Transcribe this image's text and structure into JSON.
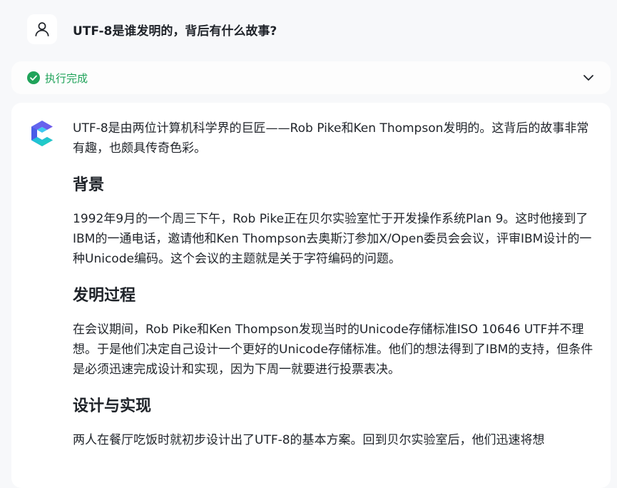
{
  "question": {
    "text": "UTF-8是谁发明的，背后有什么故事?"
  },
  "status": {
    "text": "执行完成",
    "color": "#20a35a"
  },
  "answer": {
    "intro": "UTF-8是由两位计算机科学界的巨匠——Rob Pike和Ken Thompson发明的。这背后的故事非常有趣，也颇具传奇色彩。",
    "sections": [
      {
        "heading": "背景",
        "body": "1992年9月的一个周三下午，Rob Pike正在贝尔实验室忙于开发操作系统Plan 9。这时他接到了IBM的一通电话，邀请他和Ken Thompson去奥斯汀参加X/Open委员会会议，评审IBM设计的一种Unicode编码。这个会议的主题就是关于字符编码的问题。"
      },
      {
        "heading": "发明过程",
        "body": "在会议期间，Rob Pike和Ken Thompson发现当时的Unicode存储标准ISO 10646 UTF并不理想。于是他们决定自己设计一个更好的Unicode存储标准。他们的想法得到了IBM的支持，但条件是必须迅速完成设计和实现，因为下周一就要进行投票表决。"
      },
      {
        "heading": "设计与实现",
        "body": "两人在餐厅吃饭时就初步设计出了UTF-8的基本方案。回到贝尔实验室后，他们迅速将想"
      }
    ]
  },
  "icons": {
    "user": "user-icon",
    "status": "check-circle-icon",
    "expand": "chevron-down-icon",
    "logo": "assistant-logo-icon"
  }
}
